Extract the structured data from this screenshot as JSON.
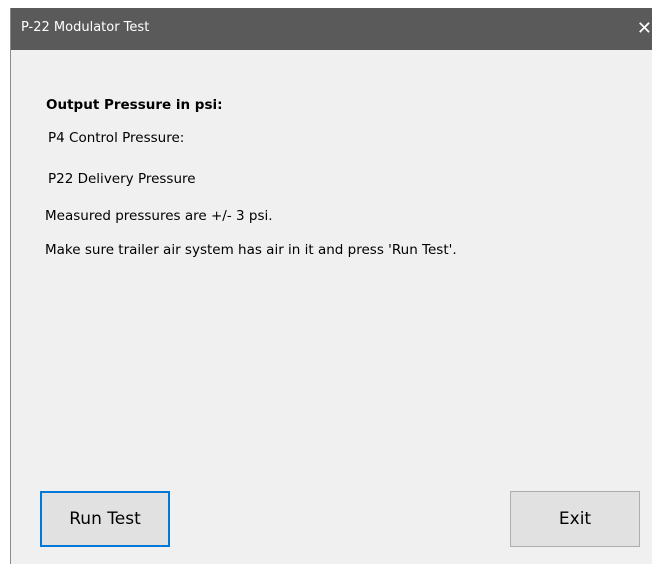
{
  "window": {
    "title": "P-22 Modulator Test",
    "close_glyph": "✕"
  },
  "content": {
    "heading": "Output Pressure in psi:",
    "p4_label": "P4 Control Pressure:",
    "p22_label": "P22 Delivery Pressure",
    "note_accuracy": "Measured pressures are +/- 3 psi.",
    "note_instruction": "Make sure trailer air system has air in it and press 'Run Test'."
  },
  "buttons": {
    "run_test": "Run Test",
    "exit": "Exit"
  },
  "colors": {
    "titlebar": "#5a5a5a",
    "window_bg": "#f0f0f0",
    "focus_border": "#0078d7"
  },
  "icons": {
    "close": "close-icon"
  }
}
